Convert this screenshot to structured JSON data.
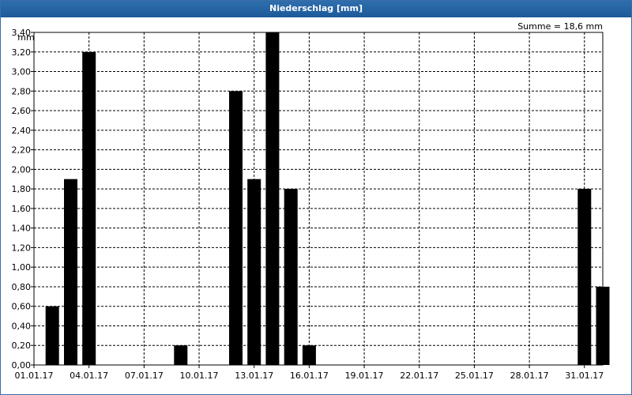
{
  "window": {
    "title": "Niederschlag [mm]"
  },
  "chart_data": {
    "type": "bar",
    "title": "Niederschlag [mm]",
    "ylabel": "mm",
    "xlabel": "",
    "sum_label": "Summe = 18,6 mm",
    "ylim": [
      0,
      3.4
    ],
    "y_ticks": [
      "0,00",
      "0,20",
      "0,40",
      "0,60",
      "0,80",
      "1,00",
      "1,20",
      "1,40",
      "1,60",
      "1,80",
      "2,00",
      "2,20",
      "2,40",
      "2,60",
      "2,80",
      "3,00",
      "3,20",
      "3,40"
    ],
    "x_ticks": [
      "01.01.17",
      "04.01.17",
      "07.01.17",
      "10.01.17",
      "13.01.17",
      "16.01.17",
      "19.01.17",
      "22.01.17",
      "25.01.17",
      "28.01.17",
      "31.01.17"
    ],
    "categories": [
      "02.01.17",
      "03.01.17",
      "04.01.17",
      "09.01.17",
      "12.01.17",
      "13.01.17",
      "14.01.17",
      "15.01.17",
      "16.01.17",
      "31.01.17",
      "01.02.17"
    ],
    "values": [
      0.6,
      1.9,
      3.2,
      0.2,
      2.8,
      1.9,
      3.4,
      1.8,
      0.2,
      1.8,
      0.8
    ],
    "grid": true,
    "colors": {
      "bar": "#000000",
      "grid": "#000000",
      "title_bar": "#2566a6"
    }
  }
}
